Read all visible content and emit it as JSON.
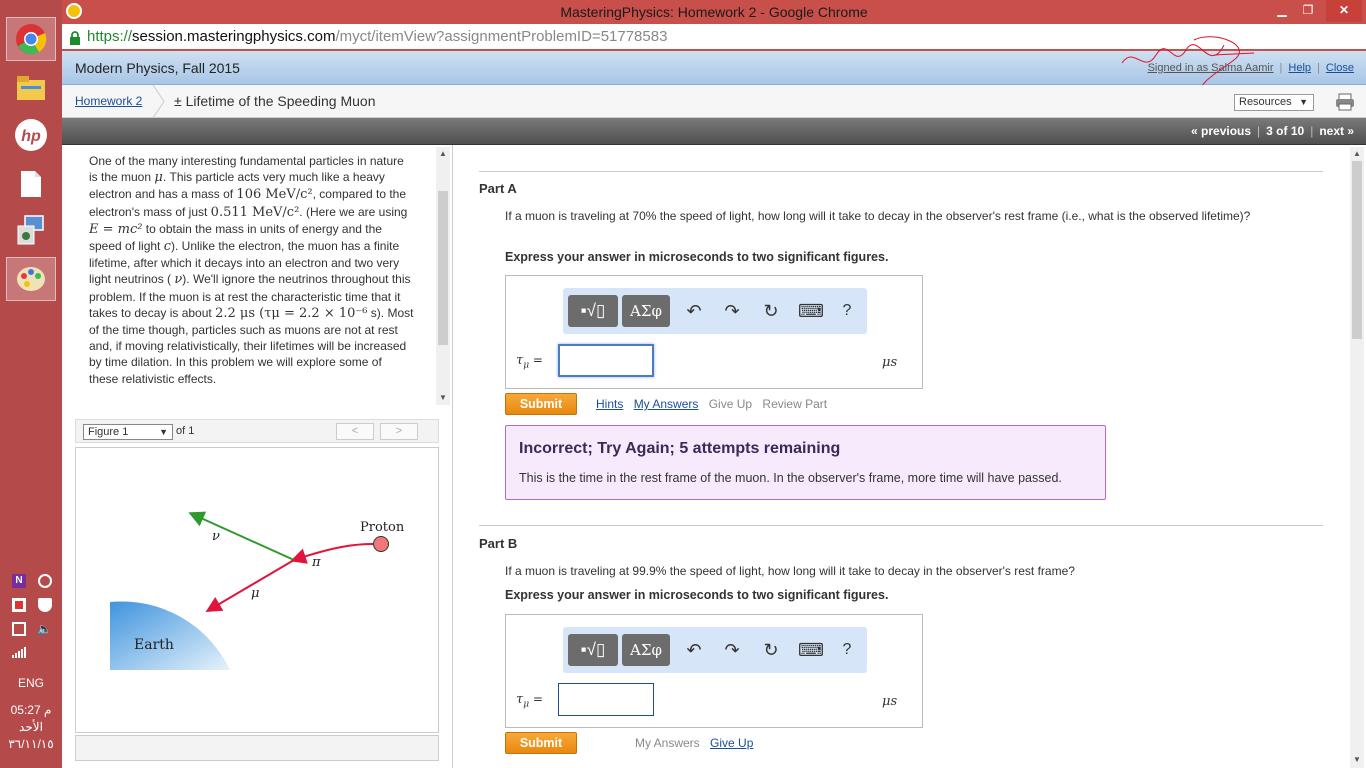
{
  "browser": {
    "window_title": "MasteringPhysics: Homework 2 - Google Chrome",
    "url_scheme": "https://",
    "url_host": "session.masteringphysics.com",
    "url_path": "/myct/itemView?assignmentProblemID=51778583"
  },
  "taskbar": {
    "language": "ENG",
    "time": "05:27 م",
    "day": "الأحد",
    "date": "٣٦/١١/١٥",
    "icons": [
      "chrome-icon",
      "file-manager-icon",
      "hp-icon",
      "document-icon",
      "network-settings-icon",
      "paint-icon"
    ],
    "tray_icons": [
      "onenote-icon",
      "sync-icon",
      "flag-icon",
      "shield-icon",
      "battery-icon",
      "volume-icon",
      "signal-icon"
    ]
  },
  "header": {
    "course": "Modern Physics, Fall 2015",
    "signed_in": "Signed in as Salma Aamir",
    "help": "Help",
    "close": "Close"
  },
  "breadcrumb": {
    "homework": "Homework 2",
    "problem": "± Lifetime of the Speeding Muon",
    "resources": "Resources"
  },
  "navigation": {
    "previous": "« previous",
    "position": "3 of 10",
    "next": "next »"
  },
  "intro": {
    "t1": "One of the many interesting fundamental particles in nature is the muon ",
    "mu": "μ",
    "t2": ". This particle acts very much like a heavy electron and has a mass of ",
    "mass": "106 MeV/c²",
    "t3": ", compared to the electron's mass of just ",
    "emass": "0.511 MeV/c²",
    "t4": ". (Here we are using ",
    "formula": "E = mc²",
    "t5": " to obtain the mass in units of energy and the speed of light ",
    "c": "c",
    "t6": "). Unlike the electron, the muon has a finite lifetime, after which it decays into an electron and two very light neutrinos ( ",
    "nu": "ν",
    "t7": "). We'll ignore the neutrinos throughout this problem. If the muon is at rest the characteristic time that it takes to decay is about ",
    "time": "2.2 μs (τμ = 2.2 × 10⁻⁶",
    "t8": " s). Most of the time though, particles such as muons are not at rest and, if moving relativistically, their lifetimes will be increased by time dilation. In this problem we will explore some of these relativistic effects."
  },
  "figure": {
    "selector": "Figure 1",
    "of": "of 1",
    "prev": "<",
    "next": ">",
    "labels": {
      "proton": "Proton",
      "pi": "π",
      "nu": "ν",
      "mu": "μ",
      "earth": "Earth"
    }
  },
  "toolbar": {
    "template_btn": "▪√▯",
    "greek_btn": "ΑΣφ",
    "undo": "↶",
    "redo": "↷",
    "reset": "↻",
    "keyboard": "⌨",
    "help": "?"
  },
  "part_a": {
    "title": "Part A",
    "question": "If a muon is traveling at 70% the speed of light, how long will it take to decay in the observer's rest frame (i.e., what is the observed lifetime)?",
    "instruction": "Express your answer in microseconds to two significant figures.",
    "var": "τ",
    "sub": "μ",
    "eq": " =",
    "value": "",
    "unit": "μs",
    "submit": "Submit",
    "hints": "Hints",
    "my_answers": "My Answers",
    "give_up": "Give Up",
    "review": "Review Part",
    "feedback_title": "Incorrect; Try Again; 5 attempts remaining",
    "feedback_msg": "This is the time in the rest frame of the muon. In the observer's frame, more time will have passed."
  },
  "part_b": {
    "title": "Part B",
    "question": "If a muon is traveling at 99.9% the speed of light, how long will it take to decay in the observer's rest frame?",
    "instruction": "Express your answer in microseconds to two significant figures.",
    "var": "τ",
    "sub": "μ",
    "eq": " =",
    "value": "",
    "unit": "μs",
    "submit": "Submit",
    "my_answers": "My Answers",
    "give_up": "Give Up"
  },
  "colors": {
    "taskbar": "#b44a4a",
    "chrome_title": "#c9504a",
    "submit": "#f0961e",
    "feedback_bg": "#f7eafc",
    "feedback_border": "#b06ad0",
    "pion_arrow": "#e0143c",
    "neutrino_arrow": "#2e9a2e"
  }
}
